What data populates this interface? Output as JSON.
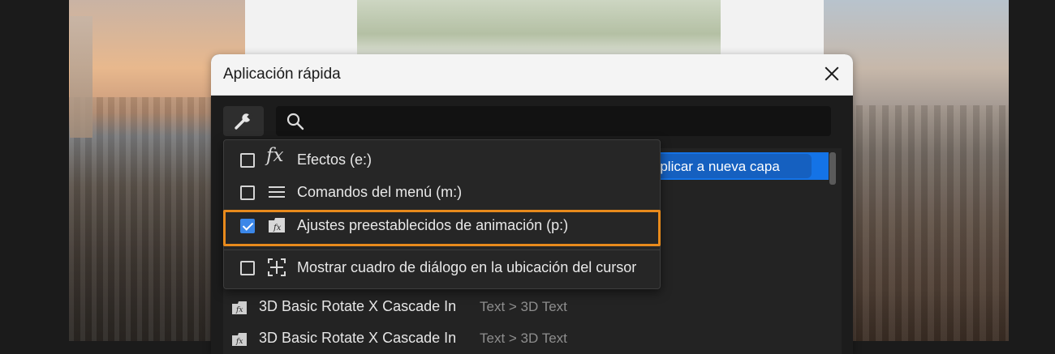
{
  "dialog": {
    "title": "Aplicación rápida",
    "search": {
      "value": "",
      "placeholder": ""
    }
  },
  "selected_action": {
    "label": "Aplicar a nueva capa"
  },
  "filter_menu": {
    "items": [
      {
        "label": "Efectos (e:)",
        "checked": false,
        "icon": "fx-icon"
      },
      {
        "label": "Comandos del menú (m:)",
        "checked": false,
        "icon": "menu-lines-icon"
      },
      {
        "label": "Ajustes preestablecidos de animación (p:)",
        "checked": true,
        "icon": "animation-preset-icon"
      },
      {
        "label": "Mostrar cuadro de diálogo en la ubicación del cursor",
        "checked": false,
        "icon": "cursor-position-icon"
      }
    ]
  },
  "results": [
    {
      "name": "3D Basic Rotate X Cascade In",
      "path": "Text > 3D Text"
    },
    {
      "name": "3D Basic Rotate X Cascade In",
      "path": "Text > 3D Text"
    }
  ],
  "colors": {
    "accent": "#1473e6",
    "highlight": "#e88a1c",
    "checkbox": "#3b87e8"
  }
}
